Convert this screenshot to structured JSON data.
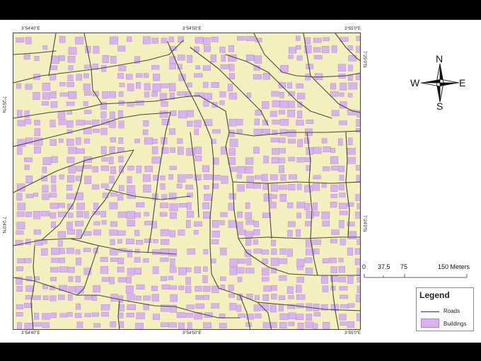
{
  "map": {
    "colors": {
      "background": "#f3efbf",
      "buildings": "#d9b3ee",
      "building_outline": "#a783c2",
      "roads": "#4a4a3a"
    },
    "coordinates": {
      "top_left": "3°54'40\"E",
      "top_mid": "3°54'50\"E",
      "top_right": "3°55'0\"E",
      "bottom_left": "3°54'40\"E",
      "bottom_mid": "3°54'50\"E",
      "bottom_right": "3°55'0\"E",
      "left_upper": "7°25'0\"N",
      "left_lower": "7°24'0\"N",
      "right_upper": "7°25'0\"N",
      "right_lower": "7°24'0\"N"
    }
  },
  "north_arrow": {
    "n": "N",
    "s": "S",
    "e": "E",
    "w": "W",
    "icon": "compass-rose-icon"
  },
  "scale_bar": {
    "labels": [
      "0",
      "37.5",
      "75",
      "150 Meters"
    ]
  },
  "legend": {
    "title": "Legend",
    "items": [
      {
        "label": "Roads",
        "symbol": "line"
      },
      {
        "label": "Buildings",
        "symbol": "polygon"
      }
    ]
  }
}
